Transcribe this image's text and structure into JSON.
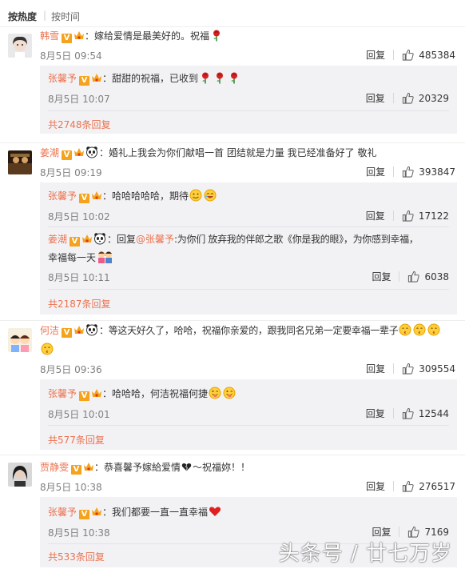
{
  "sort": {
    "hot": "按热度",
    "time": "按时间",
    "sep": "|"
  },
  "ui": {
    "reply": "回复",
    "v": "V"
  },
  "comments": [
    {
      "user": "韩雪",
      "colon": "：",
      "text": "嫁给爱情是最美好的。祝福",
      "time": "8月5日 09:54",
      "likes": "485384",
      "replies": [
        {
          "user": "张馨予",
          "text": "：甜甜的祝福，已收到",
          "time": "8月5日 10:07",
          "likes": "20329"
        }
      ],
      "more": "共2748条回复"
    },
    {
      "user": "姜潮",
      "text": "：婚礼上我会为你们献唱一首 团结就是力量 我已经准备好了 敬礼",
      "time": "8月5日 09:19",
      "likes": "393847",
      "replies": [
        {
          "user": "张馨予",
          "text": "：哈哈哈哈哈，期待",
          "time": "8月5日 10:02",
          "likes": "17122"
        },
        {
          "user": "姜潮",
          "text_a": "：回复",
          "mention": "@张馨予",
          "text_b": ":为你们 放弃我的伴郎之歌《你是我的眼》，为你感到幸福，",
          "text_c": "幸福每一天",
          "time": "8月5日 10:11",
          "likes": "6038"
        }
      ],
      "more": "共2187条回复"
    },
    {
      "user": "何洁",
      "text": "：等这天好久了，哈哈，祝福你亲爱的，跟我同名兄弟一定要幸福一辈子",
      "time": "8月5日 09:36",
      "likes": "309554",
      "replies": [
        {
          "user": "张馨予",
          "text": "：哈哈哈，何洁祝福何捷",
          "time": "8月5日 10:01",
          "likes": "12544"
        }
      ],
      "more": "共577条回复"
    },
    {
      "user": "贾静雯",
      "text": "：恭喜馨予嫁給爱情",
      "text_tail": "～祝福妳！！",
      "time": "8月5日 10:38",
      "likes": "276517",
      "replies": [
        {
          "user": "张馨予",
          "text": "：我们都要一直一直幸福",
          "time": "8月5日 10:38",
          "likes": "7169"
        }
      ],
      "more": "共533条回复"
    }
  ],
  "watermark": "头条号 / 廿七万岁",
  "colors": {
    "accent": "#eb7350",
    "reply_bg": "#f2f2f5",
    "badge": "#f5a21c"
  }
}
